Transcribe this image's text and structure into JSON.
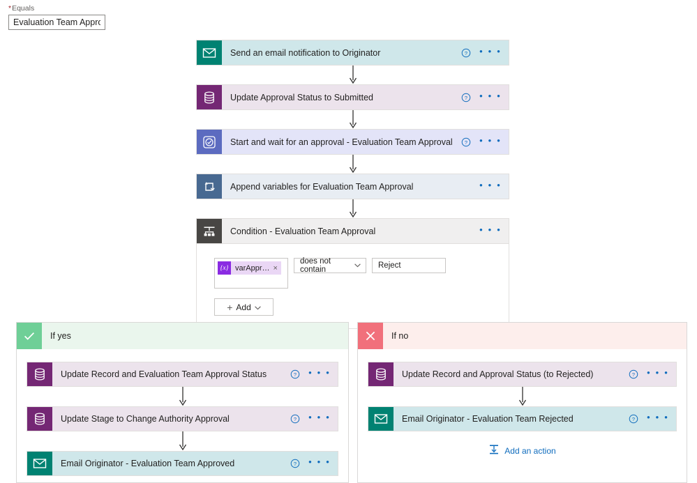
{
  "equals_field": {
    "label": "Equals",
    "required_marker": "*",
    "value": "Evaluation Team Approval"
  },
  "flow": {
    "steps": [
      {
        "title": "Send an email notification to Originator",
        "icon": "email-icon",
        "style": "c-email",
        "has_help": true,
        "has_menu": true
      },
      {
        "title": "Update Approval Status to Submitted",
        "icon": "database-icon",
        "style": "c-data",
        "has_help": true,
        "has_menu": true
      },
      {
        "title": "Start and wait for an approval - Evaluation Team Approval",
        "icon": "approval-icon",
        "style": "c-approve",
        "has_help": true,
        "has_menu": true
      },
      {
        "title": "Append variables for Evaluation Team Approval",
        "icon": "append-variable-icon",
        "style": "c-append",
        "has_help": false,
        "has_menu": true
      }
    ],
    "condition": {
      "title": "Condition - Evaluation Team Approval",
      "icon": "condition-icon",
      "style": "c-cond",
      "has_help": false,
      "has_menu": true,
      "operand": {
        "token_glyph": "{x}",
        "token_text": "varAppr…",
        "remove_label": "×"
      },
      "operator": "does not contain",
      "value": "Reject",
      "add_button": "Add",
      "add_plus": "+",
      "chevron": "⌄"
    }
  },
  "branches": {
    "yes": {
      "label": "If yes",
      "badge_icon": "checkmark-icon",
      "steps": [
        {
          "title": "Update Record and Evaluation Team Approval Status",
          "icon": "database-icon",
          "style": "c-data",
          "has_help": true,
          "has_menu": true
        },
        {
          "title": "Update Stage to Change Authority Approval",
          "icon": "database-icon",
          "style": "c-data",
          "has_help": true,
          "has_menu": true
        },
        {
          "title": "Email Originator - Evaluation Team Approved",
          "icon": "email-icon",
          "style": "c-email",
          "has_help": true,
          "has_menu": true
        }
      ]
    },
    "no": {
      "label": "If no",
      "badge_icon": "cross-icon",
      "steps": [
        {
          "title": "Update Record and Approval Status (to Rejected)",
          "icon": "database-icon",
          "style": "c-data",
          "has_help": true,
          "has_menu": true
        },
        {
          "title": "Email Originator - Evaluation Team Rejected",
          "icon": "email-icon",
          "style": "c-email",
          "has_help": true,
          "has_menu": true
        }
      ],
      "add_action_label": "Add an action",
      "add_action_icon": "insert-step-icon"
    }
  },
  "colors": {
    "email_accent": "#008272",
    "data_accent": "#742774",
    "approval_accent": "#5c6bc0",
    "append_accent": "#486991",
    "condition_accent": "#484644",
    "yes_accent": "#6fcf97",
    "no_accent": "#f1707b",
    "link_blue": "#0f6cbd",
    "required_red": "#a4262c"
  },
  "dots_glyph": "• • •"
}
